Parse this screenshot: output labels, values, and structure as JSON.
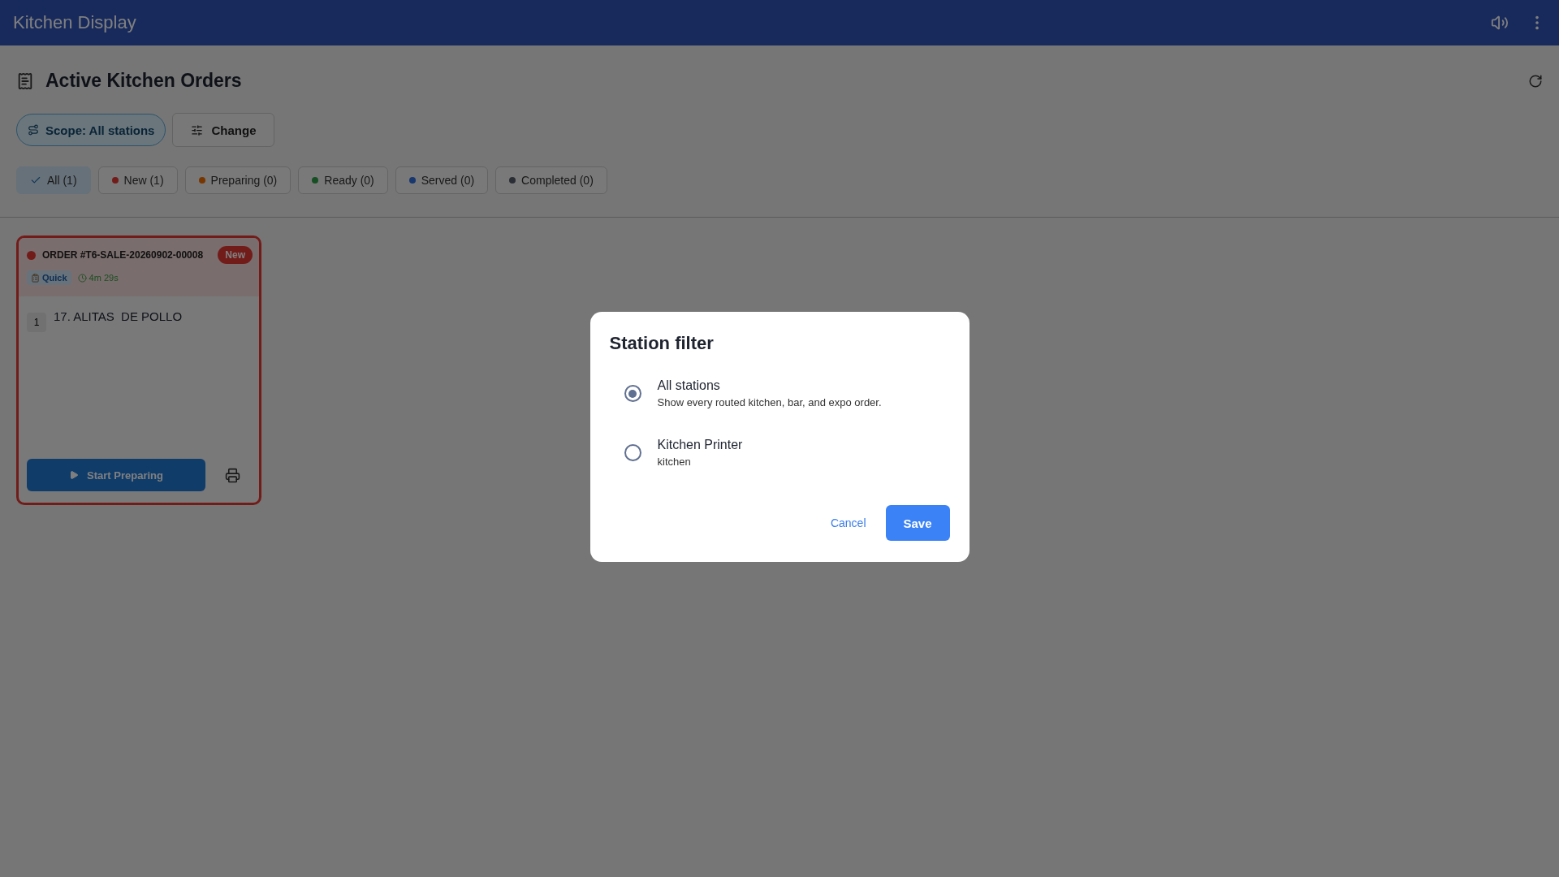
{
  "app_bar": {
    "title": "Kitchen Display"
  },
  "page": {
    "title": "Active Kitchen Orders"
  },
  "scope": {
    "chip": "Scope: All stations",
    "change_button": "Change"
  },
  "filters": [
    {
      "label": "All (1)",
      "selected": true
    },
    {
      "label": "New (1)",
      "selected": false,
      "color": "#721c1a"
    },
    {
      "label": "Preparing (0)",
      "selected": false,
      "color": "#773600"
    },
    {
      "label": "Ready (0)",
      "selected": false,
      "color": "#174f24"
    },
    {
      "label": "Served (0)",
      "selected": false,
      "color": "#17376e"
    },
    {
      "label": "Completed (0)",
      "selected": false,
      "color": "#2a2d33"
    }
  ],
  "orders": [
    {
      "title": "ORDER #T6-SALE-20260902-00008",
      "status": "New",
      "color": "#721c1a",
      "tag": "Quick",
      "elapsed": "4m 29s",
      "items": [
        {
          "qty": "1",
          "name": "17. ALITAS  DE POLLO"
        }
      ],
      "action": "Start Preparing"
    }
  ],
  "dialog": {
    "title": "Station filter",
    "options": [
      {
        "label": "All stations",
        "description": "Show every routed kitchen, bar, and expo order.",
        "selected": true
      },
      {
        "label": "Kitchen Printer",
        "description": "kitchen",
        "selected": false
      }
    ],
    "cancel": "Cancel",
    "save": "Save"
  }
}
